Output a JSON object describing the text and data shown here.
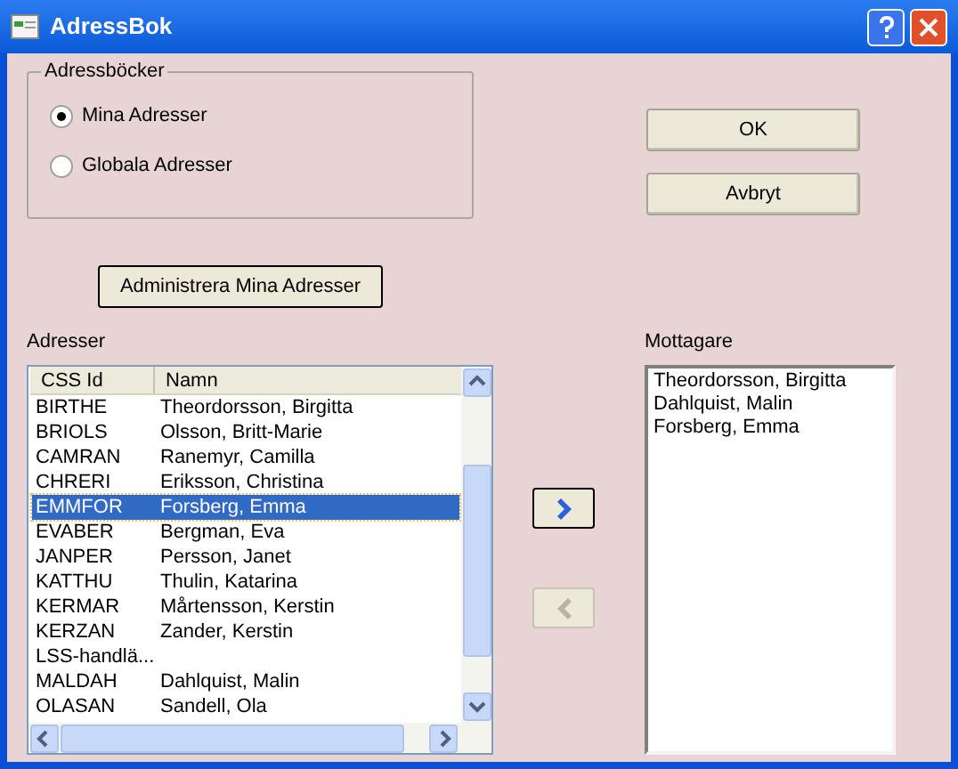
{
  "window": {
    "title": "AdressBok"
  },
  "address_books": {
    "title": "Adressböcker",
    "options": [
      {
        "label": "Mina Adresser",
        "selected": true
      },
      {
        "label": "Globala Adresser",
        "selected": false
      }
    ]
  },
  "buttons": [
    "OK",
    "Avbryt"
  ],
  "manage_button": "Administrera Mina Adresser",
  "addresses": {
    "label": "Adresser",
    "columns": [
      "CSS Id",
      "Namn"
    ],
    "rows": [
      {
        "id": "BIRTHE",
        "name": "Theordorsson, Birgitta",
        "selected": false
      },
      {
        "id": "BRIOLS",
        "name": "Olsson, Britt-Marie",
        "selected": false
      },
      {
        "id": "CAMRAN",
        "name": "Ranemyr, Camilla",
        "selected": false
      },
      {
        "id": "CHRERI",
        "name": "Eriksson, Christina",
        "selected": false
      },
      {
        "id": "EMMFOR",
        "name": "Forsberg, Emma",
        "selected": true
      },
      {
        "id": "EVABER",
        "name": "Bergman, Eva",
        "selected": false
      },
      {
        "id": "JANPER",
        "name": "Persson, Janet",
        "selected": false
      },
      {
        "id": "KATTHU",
        "name": "Thulin, Katarina",
        "selected": false
      },
      {
        "id": "KERMAR",
        "name": "Mårtensson, Kerstin",
        "selected": false
      },
      {
        "id": "KERZAN",
        "name": "Zander, Kerstin",
        "selected": false
      },
      {
        "id": "LSS-handlä...",
        "selected": false
      },
      {
        "id": "MALDAH",
        "name": "Dahlquist, Malin",
        "selected": false
      },
      {
        "id": "OLASAN",
        "name": "Sandell, Ola",
        "selected": false
      }
    ]
  },
  "move_buttons": [
    {
      "kind": "add",
      "disabled": false
    },
    {
      "kind": "remove",
      "disabled": true
    }
  ],
  "recipients": {
    "label": "Mottagare",
    "items": [
      "Theordorsson, Birgitta",
      "Dahlquist, Malin",
      "Forsberg, Emma"
    ]
  }
}
